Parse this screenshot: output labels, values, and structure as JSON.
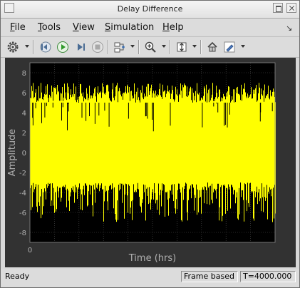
{
  "window": {
    "title": "Delay Difference"
  },
  "menu": [
    {
      "label": "File",
      "mnemonic": "F",
      "rest": "ile"
    },
    {
      "label": "Tools",
      "mnemonic": "T",
      "rest": "ools"
    },
    {
      "label": "View",
      "mnemonic": "V",
      "rest": "iew"
    },
    {
      "label": "Simulation",
      "mnemonic": "S",
      "rest": "imulation"
    },
    {
      "label": "Help",
      "mnemonic": "H",
      "rest": "elp"
    }
  ],
  "toolbar_icons": [
    "gear-icon",
    "step-back-icon",
    "run-icon",
    "step-forward-icon",
    "stop-icon",
    "signal-select-icon",
    "zoom-in-icon",
    "autoscale-icon",
    "highlight-block-icon",
    "style-icon"
  ],
  "colors": {
    "plot_bg": "#000000",
    "figure_bg": "#323232",
    "signal": "#ffff00",
    "axis_text": "#b0b0b0",
    "grid": "#505050"
  },
  "chart_data": {
    "type": "line",
    "xlabel": "Time (hrs)",
    "ylabel": "Amplitude",
    "x_ticks": [
      "0"
    ],
    "y_ticks": [
      "8",
      "6",
      "4",
      "2",
      "0",
      "-2",
      "-4",
      "-6",
      "-8"
    ],
    "ylim": [
      -9,
      9
    ],
    "grid": true,
    "series": [
      {
        "color": "#ffff00",
        "band_core": [
          -3,
          5
        ],
        "band_typical": [
          -4,
          6
        ],
        "band_max": [
          -7,
          7
        ]
      }
    ]
  },
  "status": {
    "ready": "Ready",
    "frame": "Frame based",
    "time": "T=4000.000"
  }
}
